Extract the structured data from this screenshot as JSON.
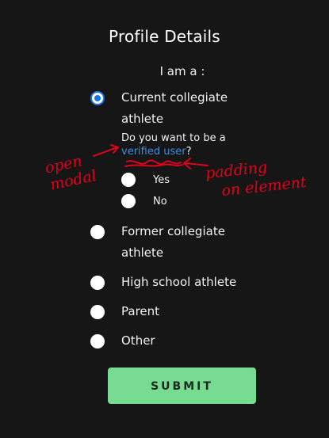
{
  "page": {
    "title": "Profile Details",
    "prompt": "I am a :"
  },
  "options": [
    {
      "line1": "Current collegiate",
      "line2": "athlete",
      "selected": true
    },
    {
      "line1": "Former collegiate",
      "line2": "athlete",
      "selected": false
    },
    {
      "line1": "High school athlete",
      "selected": false
    },
    {
      "line1": "Parent",
      "selected": false
    },
    {
      "line1": "Other",
      "selected": false
    }
  ],
  "verify": {
    "question": "Do you want to be a",
    "link": "verified user",
    "question_end": "?",
    "yes": "Yes",
    "no": "No"
  },
  "annotations": {
    "left_note": "open modal",
    "right_note": "padding on element",
    "color": "#e0001b"
  },
  "submit": {
    "label": "SUBMIT"
  },
  "colors": {
    "background": "#161616",
    "accent": "#1a73e8",
    "link": "#3d8fe0",
    "submit_bg": "#77db92"
  }
}
